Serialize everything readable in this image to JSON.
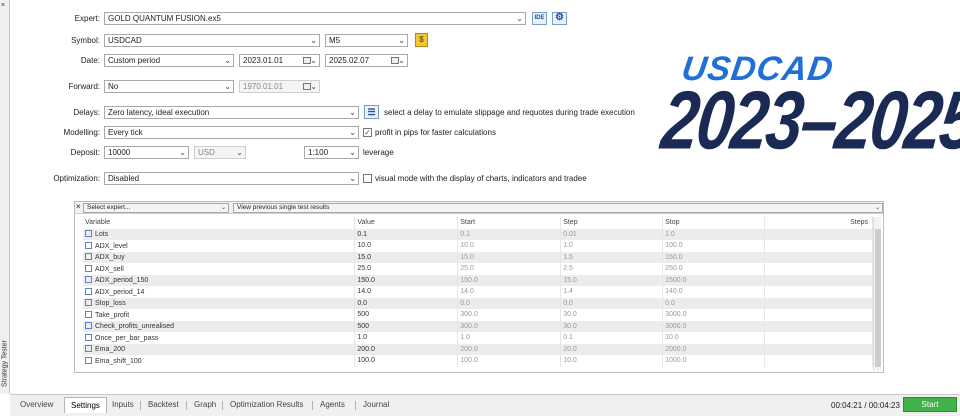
{
  "side_panel": {
    "label": "Strategy Tester",
    "close": "×"
  },
  "settings": {
    "expert": {
      "label": "Expert:",
      "value": "GOLD QUANTUM FUSION.ex5",
      "ide": "IDE"
    },
    "symbol": {
      "label": "Symbol:",
      "value": "USDCAD",
      "timeframe": "M5"
    },
    "date": {
      "label": "Date:",
      "mode": "Custom period",
      "from": "2023.01.01",
      "to": "2025.02.07"
    },
    "forward": {
      "label": "Forward:",
      "value": "No",
      "date": "1970.01.01"
    },
    "delays": {
      "label": "Delays:",
      "value": "Zero latency, ideal execution",
      "hint": "select a delay to emulate slippage and requotes during trade execution"
    },
    "modelling": {
      "label": "Modelling:",
      "value": "Every tick",
      "option": "profit in pips for faster calculations",
      "option_checked": true
    },
    "deposit": {
      "label": "Deposit:",
      "value": "10000",
      "currency": "USD",
      "leverage_value": "1:100",
      "leverage_label": "leverage"
    },
    "optimization": {
      "label": "Optimization:",
      "value": "Disabled",
      "visual_option": "visual mode with the display of charts, indicators and tradee",
      "visual_checked": false
    }
  },
  "overlay": {
    "line1": "USDCAD",
    "line2": "2023–2025",
    "color1": "#1f6fd6",
    "color2": "#1b2a55"
  },
  "params": {
    "select_expert": "Select expert...",
    "view_results": "View previous single test results",
    "columns": [
      "Variable",
      "Value",
      "Start",
      "Step",
      "Stop",
      "Steps"
    ],
    "rows": [
      {
        "name": "Lots",
        "value": "0.1",
        "start": "0.1",
        "step": "0.01",
        "stop": "1.0",
        "checked": false
      },
      {
        "name": "ADX_level",
        "value": "10.0",
        "start": "10.0",
        "step": "1.0",
        "stop": "100.0",
        "checked": false
      },
      {
        "name": "ADX_buy",
        "value": "15.0",
        "start": "15.0",
        "step": "1.5",
        "stop": "150.0",
        "checked": false
      },
      {
        "name": "ADX_sell",
        "value": "25.0",
        "start": "25.0",
        "step": "2.5",
        "stop": "250.0",
        "checked": false
      },
      {
        "name": "ADX_period_150",
        "value": "150.0",
        "start": "150.0",
        "step": "15.0",
        "stop": "1500.0",
        "checked": false
      },
      {
        "name": "ADX_period_14",
        "value": "14.0",
        "start": "14.0",
        "step": "1.4",
        "stop": "140.0",
        "checked": false
      },
      {
        "name": "Stop_loss",
        "value": "0.0",
        "start": "0.0",
        "step": "0.0",
        "stop": "0.0",
        "checked": false
      },
      {
        "name": "Take_profit",
        "value": "500",
        "start": "300.0",
        "step": "30.0",
        "stop": "3000.0",
        "checked": false
      },
      {
        "name": "Check_profits_unrealised",
        "value": "500",
        "start": "300.0",
        "step": "30.0",
        "stop": "3000.0",
        "checked": false
      },
      {
        "name": "Once_per_bar_pass",
        "value": "1.0",
        "start": "1.0",
        "step": "0.1",
        "stop": "10.0",
        "checked": false
      },
      {
        "name": "Ema_200",
        "value": "200.0",
        "start": "200.0",
        "step": "20.0",
        "stop": "2000.0",
        "checked": false
      },
      {
        "name": "Ema_shift_100",
        "value": "100.0",
        "start": "100.0",
        "step": "10.0",
        "stop": "1000.0",
        "checked": false
      }
    ]
  },
  "tabs": [
    "Overview",
    "Settings",
    "Inputs",
    "Backtest",
    "Graph",
    "Optimization Results",
    "Agents",
    "Journal"
  ],
  "active_tab": "Settings",
  "status": {
    "timer": "00:04:21 / 00:04:23",
    "start_label": "Start"
  }
}
